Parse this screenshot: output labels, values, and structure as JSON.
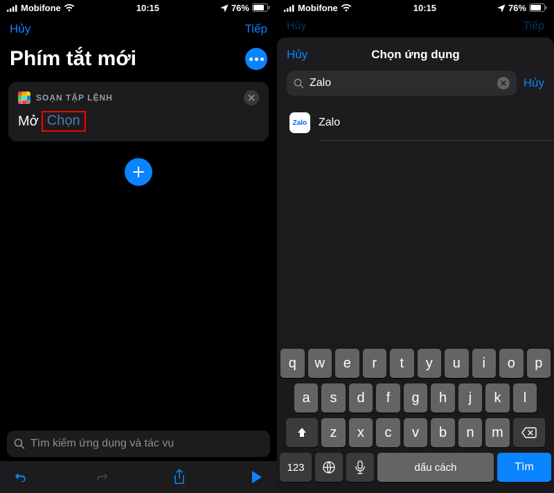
{
  "statusbar": {
    "carrier": "Mobifone",
    "time": "10:15",
    "battery": "76%"
  },
  "left": {
    "nav_cancel": "Hủy",
    "nav_next": "Tiếp",
    "title": "Phím tắt mới",
    "card": {
      "section": "SOẠN TẬP LỆNH",
      "open_label": "Mở",
      "choose_label": "Chọn"
    },
    "search_placeholder": "Tìm kiếm ứng dụng và tác vụ"
  },
  "right": {
    "dim_cancel": "Hủy",
    "dim_next": "Tiếp",
    "sheet": {
      "cancel": "Hủy",
      "title": "Chọn ứng dụng",
      "search_value": "Zalo",
      "search_cancel": "Hủy",
      "results": [
        {
          "name": "Zalo"
        }
      ]
    },
    "keyboard": {
      "row1": [
        "q",
        "w",
        "e",
        "r",
        "t",
        "y",
        "u",
        "i",
        "o",
        "p"
      ],
      "row2": [
        "a",
        "s",
        "d",
        "f",
        "g",
        "h",
        "j",
        "k",
        "l"
      ],
      "row3": [
        "z",
        "x",
        "c",
        "v",
        "b",
        "n",
        "m"
      ],
      "k123": "123",
      "space": "dấu cách",
      "search": "Tìm"
    }
  }
}
